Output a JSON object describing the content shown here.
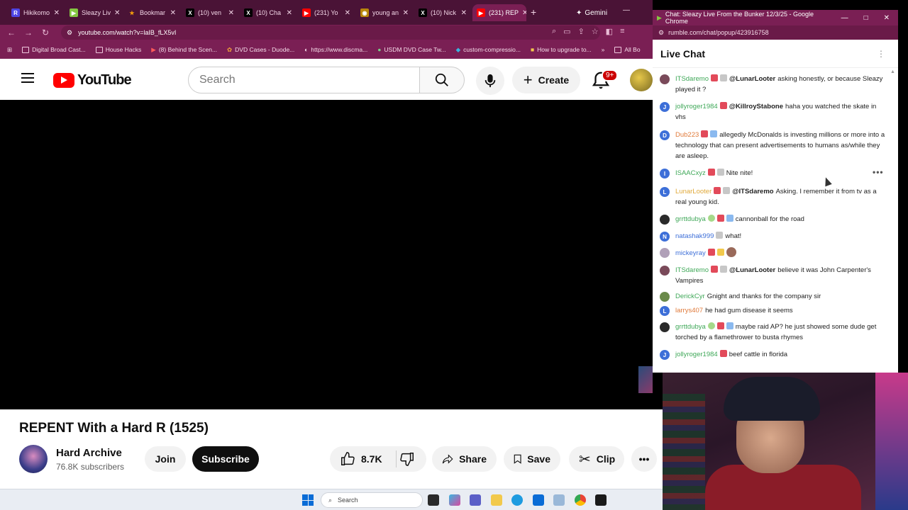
{
  "browser": {
    "tabs": [
      {
        "label": "Hikikomo",
        "fav_color": "#4f46e5",
        "fav_glyph": "R"
      },
      {
        "label": "Sleazy Liv",
        "fav_color": "#85c742",
        "fav_glyph": "▶"
      },
      {
        "label": "Bookmar",
        "fav_color": "#f59e0b",
        "fav_glyph": "★"
      },
      {
        "label": "(10) ven",
        "fav_color": "#000000",
        "fav_glyph": "X"
      },
      {
        "label": "(10) Cha",
        "fav_color": "#000000",
        "fav_glyph": "X"
      },
      {
        "label": "(231) Yo",
        "fav_color": "#ff0000",
        "fav_glyph": "▶"
      },
      {
        "label": "young an",
        "fav_color": "#b8860b",
        "fav_glyph": "◉"
      },
      {
        "label": "(10) Nick",
        "fav_color": "#000000",
        "fav_glyph": "X"
      },
      {
        "label": "(231) REP",
        "fav_color": "#ff0000",
        "fav_glyph": "▶"
      }
    ],
    "new_tab": "+",
    "gemini_label": "Gemini",
    "url": "youtube.com/watch?v=laIB_fLX5vI",
    "bookmarks": [
      "Digital Broad Cast...",
      "House Hacks",
      "(8) Behind the Scen...",
      "DVD Cases - Duode...",
      "https://www.discma...",
      "USDM DVD Case Tw...",
      "custom-compressio...",
      "How to upgrade to..."
    ],
    "bookmarks_overflow": "»",
    "all_bookmarks": "All Bo"
  },
  "youtube": {
    "search_placeholder": "Search",
    "create_label": "Create",
    "notif_badge": "9+",
    "video_title": "REPENT With a Hard R (1525)",
    "channel_name": "Hard Archive",
    "subscribers": "76.8K subscribers",
    "join_label": "Join",
    "subscribe_label": "Subscribe",
    "like_count": "8.7K",
    "share_label": "Share",
    "save_label": "Save",
    "clip_label": "Clip",
    "more_label": "•••"
  },
  "taskbar": {
    "search_label": "Search"
  },
  "chat_window": {
    "title": "Chat: Sleazy Live From the Bunker 12/3/25 - Google Chrome",
    "url": "rumble.com/chat/popup/423916758",
    "header": "Live Chat",
    "messages": [
      {
        "user": "ITSdaremo",
        "color": "#3fa858",
        "avatar": "img",
        "av_color": "#7a4a5a",
        "mention": "@LunarLooter",
        "text": "asking honestly, or because Sleazy played it ?",
        "badges": [
          "b-red",
          "b-gray"
        ]
      },
      {
        "user": "jollyroger1984",
        "color": "#3fa858",
        "avatar": "J",
        "av_color": "#3d6fd8",
        "mention": "@KillroyStabone",
        "text": "haha you watched the skate in vhs",
        "badges": [
          "b-red"
        ]
      },
      {
        "user": "Dub223",
        "color": "#e07a3a",
        "avatar": "D",
        "av_color": "#3d6fd8",
        "mention": "",
        "text": "allegedly McDonalds is investing millions or more into a technology that can present advertisements to humans as/while they are asleep.",
        "badges": [
          "b-red",
          "b-blue"
        ]
      },
      {
        "user": "ISAACxyz",
        "color": "#3fa858",
        "avatar": "I",
        "av_color": "#3d6fd8",
        "mention": "",
        "text": "Nite nite!",
        "badges": [
          "b-red",
          "b-gray"
        ]
      },
      {
        "user": "LunarLooter",
        "color": "#e0a93a",
        "avatar": "L",
        "av_color": "#3d6fd8",
        "mention": "@ITSdaremo",
        "text": "Asking. I remember it from tv as a real young kid.",
        "badges": [
          "b-red",
          "b-gray"
        ]
      },
      {
        "user": "grrttdubya",
        "color": "#3fa858",
        "avatar": "img",
        "av_color": "#2a2a2a",
        "mention": "",
        "text": "cannonball for the road",
        "badges": [
          "b-green",
          "b-red",
          "b-blue"
        ]
      },
      {
        "user": "natashak999",
        "color": "#3d6fd8",
        "avatar": "N",
        "av_color": "#3d6fd8",
        "mention": "",
        "text": "what!",
        "badges": [
          "b-gray"
        ]
      },
      {
        "user": "mickeyray",
        "color": "#3d6fd8",
        "avatar": "img",
        "av_color": "#b0a0b8",
        "mention": "",
        "text": "",
        "badges": [
          "b-red",
          "b-gold"
        ]
      },
      {
        "user": "ITSdaremo",
        "color": "#3fa858",
        "avatar": "img",
        "av_color": "#7a4a5a",
        "mention": "@LunarLooter",
        "text": "believe it was John Carpenter's Vampires",
        "badges": [
          "b-red",
          "b-gray"
        ]
      },
      {
        "user": "DerickCyr",
        "color": "#3fa858",
        "avatar": "img",
        "av_color": "#6a8a4a",
        "mention": "",
        "text": "Gnight and thanks for the company sir",
        "badges": []
      },
      {
        "user": "larrys407",
        "color": "#e07a3a",
        "avatar": "L",
        "av_color": "#3d6fd8",
        "mention": "",
        "text": "he had gum disease it seems",
        "badges": []
      },
      {
        "user": "grrttdubya",
        "color": "#3fa858",
        "avatar": "img",
        "av_color": "#2a2a2a",
        "mention": "",
        "text": "maybe raid AP? he just showed some dude get torched by a flamethrower to busta rhymes",
        "badges": [
          "b-green",
          "b-red",
          "b-blue"
        ]
      },
      {
        "user": "jollyroger1984",
        "color": "#3fa858",
        "avatar": "J",
        "av_color": "#3d6fd8",
        "mention": "",
        "text": "beef cattle in florida",
        "badges": [
          "b-red"
        ]
      }
    ]
  }
}
